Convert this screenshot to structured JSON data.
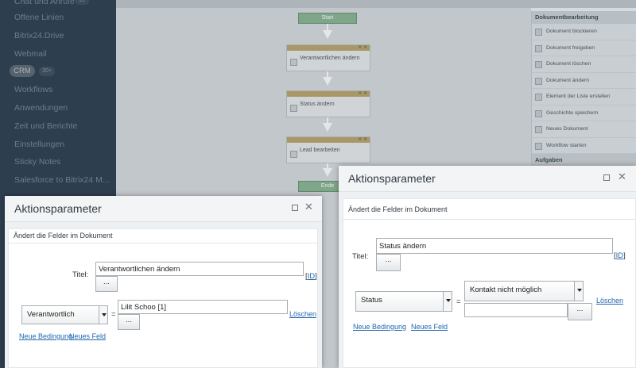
{
  "sidebar": {
    "top_cut_label": "Chat und Anrufe",
    "top_badge": "12",
    "items": [
      "Offene Linien",
      "Bitrix24.Drive",
      "Webmail",
      "CRM",
      "Workflows",
      "Anwendungen",
      "Zeit und Berichte",
      "Einstellungen",
      "Sticky Notes",
      "Salesforce to Bitrix24 M..."
    ],
    "crm_badge": "30+"
  },
  "workflow": {
    "start": "Start",
    "end": "Ende",
    "blocks": [
      "Verantwortlichen ändern",
      "Status ändern",
      "Lead bearbeiten"
    ]
  },
  "palette": {
    "header": "Dokumentbearbeitung",
    "items": [
      "Dokument blockieren",
      "Dokument freigeben",
      "Dokument löschen",
      "Dokument ändern",
      "Element der Liste erstellen",
      "Geschichte speichern",
      "Neues Dokument",
      "Workflow starten"
    ],
    "next_header": "Aufgaben"
  },
  "dialog_left": {
    "title": "Aktionsparameter",
    "section": "Ändert die Felder im Dokument",
    "title_label": "Titel:",
    "title_value": "Verantwortlichen ändern",
    "dots": "...",
    "id_link": "ID",
    "field_select": "Verantwortlich",
    "equals": "=",
    "field_value": "Lilit Schoo [1]",
    "delete_link": "Löschen",
    "new_condition": "Neue Bedingung",
    "new_field": "Neues Feld"
  },
  "dialog_right": {
    "title": "Aktionsparameter",
    "section": "Ändert die Felder im Dokument",
    "title_label": "Titel:",
    "title_value": "Status ändern",
    "dots": "...",
    "id_link": "ID",
    "field_select": "Status",
    "equals": "=",
    "value_select": "Kontakt nicht möglich",
    "value_text": "",
    "delete_link": "Löschen",
    "new_condition": "Neue Bedingung",
    "new_field": "Neues Feld"
  }
}
